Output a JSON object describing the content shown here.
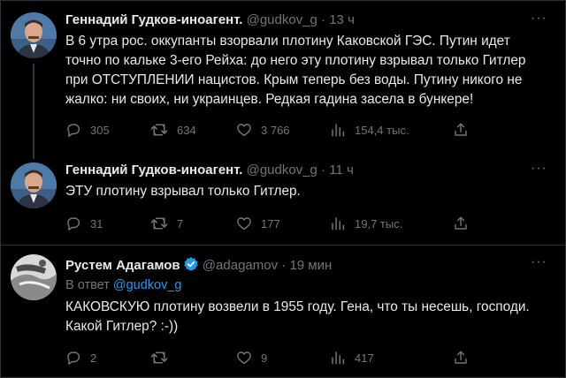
{
  "tweets": [
    {
      "author_name": "Геннадий Гудков-иноагент.",
      "handle": "@gudkov_g",
      "separator": "·",
      "time": "13 ч",
      "text_lines": [
        "В 6 утра рос. оккупанты взорвали плотину Каковской ГЭС. Путин идет",
        "точно по кальке 3-его Рейха: до него эту плотину взрывал только Гитлер",
        "при ОТСТУПЛЕНИИ нацистов. Крым теперь без воды. Путину никого не",
        "жалко: ни своих, ни украинцев. Редкая гадина засела в бункере!"
      ],
      "replies": "305",
      "retweets": "634",
      "likes": "3 766",
      "views": "154,4 тыс."
    },
    {
      "author_name": "Геннадий Гудков-иноагент.",
      "handle": "@gudkov_g",
      "separator": "·",
      "time": "11 ч",
      "text_lines": [
        "ЭТУ плотину взрывал только Гитлер."
      ],
      "replies": "31",
      "retweets": "7",
      "likes": "177",
      "views": "19,7 тыс."
    },
    {
      "author_name": "Рустем Адагамов",
      "verified": true,
      "handle": "@adagamov",
      "separator": "·",
      "time": "19 мин",
      "reply_prefix": "В ответ",
      "reply_handle": "@gudkov_g",
      "text_lines": [
        "КАКОВСКУЮ плотину возвели в 1955 году. Гена, что ты несешь, господи.",
        "Какой Гитлер? :-))"
      ],
      "replies": "2",
      "retweets": "",
      "likes": "9",
      "views": "417"
    }
  ],
  "more_label": "···",
  "colors": {
    "background": "#000000",
    "text": "#e7e9ea",
    "muted": "#71767b",
    "link": "#1d9bf0",
    "verified": "#1d9bf0"
  },
  "icons": [
    "reply-icon",
    "retweet-icon",
    "like-icon",
    "views-icon",
    "share-icon",
    "verified-badge-icon",
    "more-icon"
  ]
}
